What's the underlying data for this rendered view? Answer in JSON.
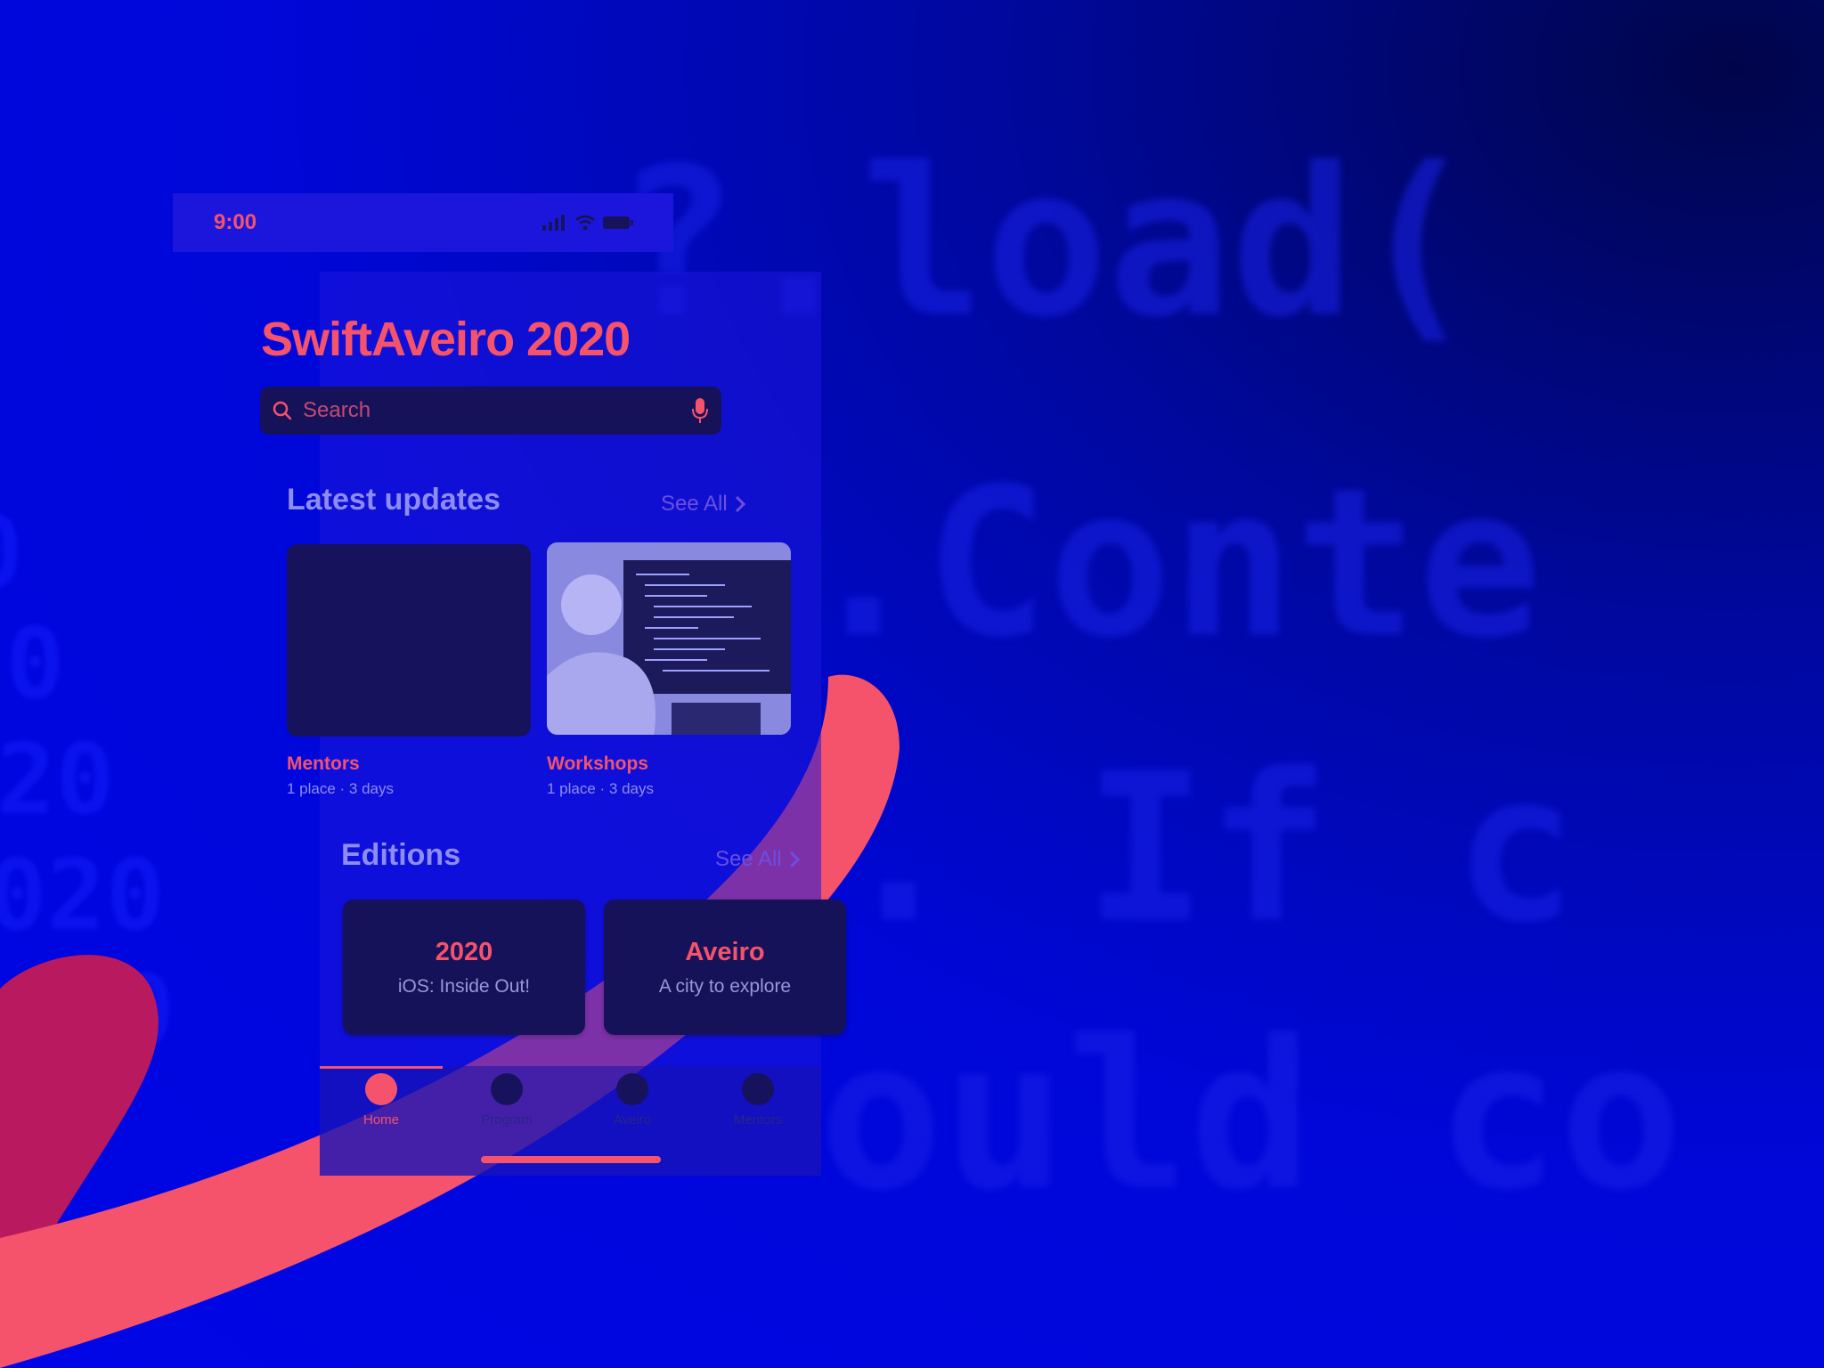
{
  "colors": {
    "accent": "#f4536b",
    "background": "#0007d8",
    "card": "#161259",
    "muted": "#8d8cf0"
  },
  "status_bar": {
    "time": "9:00",
    "icons": [
      "signal-icon",
      "wifi-icon",
      "battery-icon"
    ]
  },
  "app": {
    "title": "SwiftAveiro 2020"
  },
  "search": {
    "placeholder": "Search",
    "value": ""
  },
  "latest_updates": {
    "title": "Latest updates",
    "see_all": "See All",
    "items": [
      {
        "name": "Mentors",
        "meta": "1 place · 3 days"
      },
      {
        "name": "Workshops",
        "meta": "1 place · 3 days"
      }
    ]
  },
  "editions": {
    "title": "Editions",
    "see_all": "See All",
    "items": [
      {
        "title": "2020",
        "subtitle": "iOS: Inside Out!"
      },
      {
        "title": "Aveiro",
        "subtitle": "A city to explore"
      }
    ]
  },
  "tab_bar": {
    "tabs": [
      {
        "label": "Home",
        "active": true
      },
      {
        "label": "Program",
        "active": false
      },
      {
        "label": "Aveiro",
        "active": false
      },
      {
        "label": "Mentors",
        "active": false
      }
    ]
  }
}
